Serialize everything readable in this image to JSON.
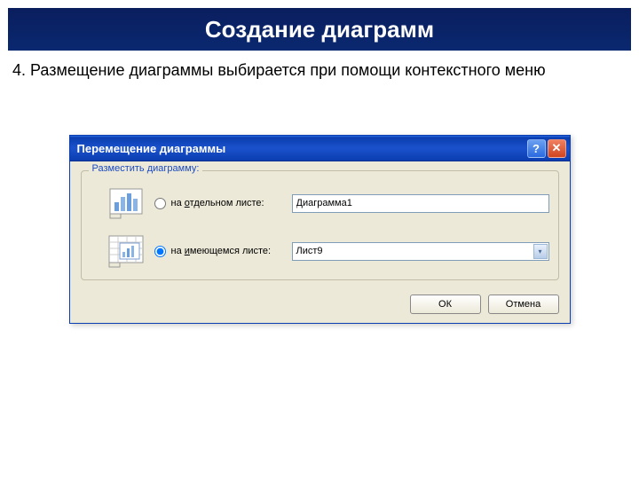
{
  "page": {
    "title": "Создание диаграмм",
    "instruction": "4. Размещение диаграммы выбирается при помощи контекстного меню"
  },
  "dialog": {
    "title": "Перемещение диаграммы",
    "group_label": "Разместить диаграмму:",
    "option1": {
      "label_prefix": "на ",
      "mnemonic": "о",
      "label_suffix": "тдельном листе:",
      "value": "Диаграмма1"
    },
    "option2": {
      "label_prefix": "на ",
      "mnemonic": "и",
      "label_suffix": "меющемся листе:",
      "value": "Лист9"
    },
    "buttons": {
      "ok": "ОК",
      "cancel": "Отмена"
    }
  }
}
